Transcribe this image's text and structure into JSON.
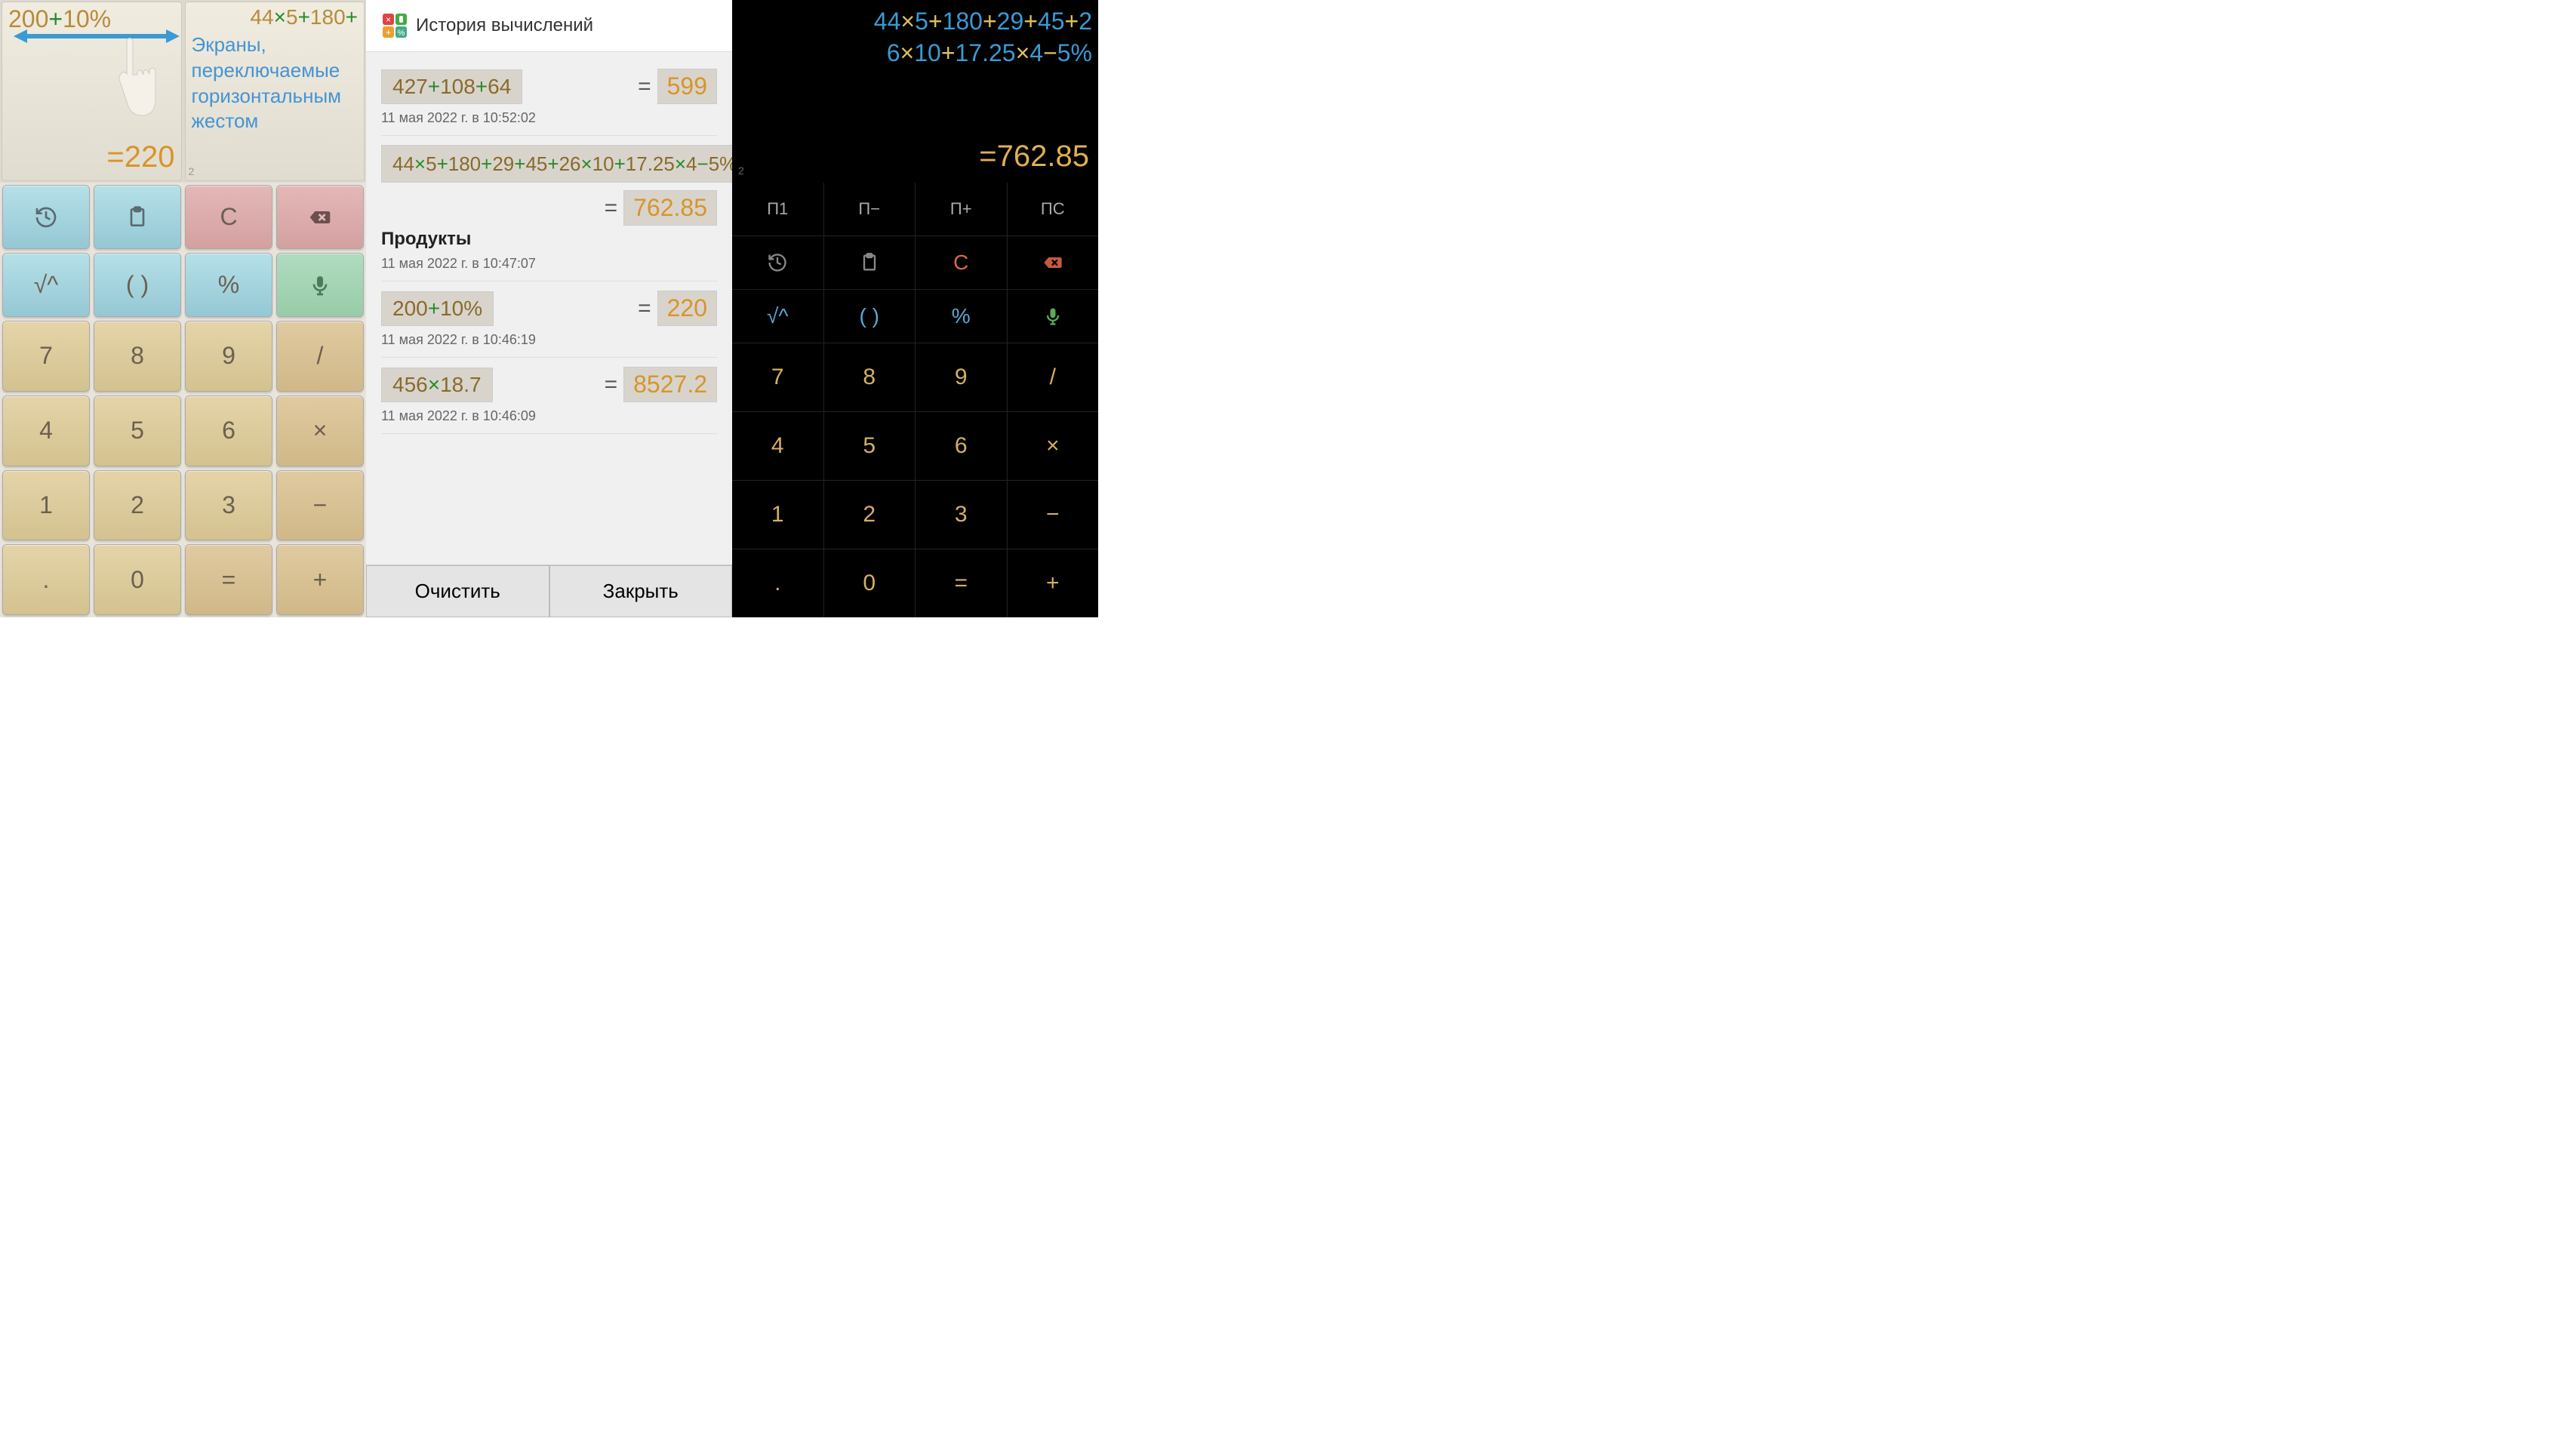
{
  "panel1": {
    "tab1": {
      "expr_parts": [
        "200",
        "+",
        "10%"
      ],
      "result": "=220"
    },
    "tab2": {
      "expr_parts": [
        "44",
        "×",
        "5",
        "+",
        "180",
        "+"
      ],
      "hint": "Экраны, переключаемые горизонтальным жестом",
      "page": "2"
    },
    "keys": {
      "c": "C",
      "root": "√^",
      "paren": "( )",
      "pct": "%",
      "n7": "7",
      "n8": "8",
      "n9": "9",
      "div": "/",
      "n4": "4",
      "n5": "5",
      "n6": "6",
      "mul": "×",
      "n1": "1",
      "n2": "2",
      "n3": "3",
      "sub": "−",
      "dot": ".",
      "n0": "0",
      "eq": "=",
      "add": "+"
    }
  },
  "panel2": {
    "title": "История вычислений",
    "entries": [
      {
        "expr_parts": [
          "427",
          "+",
          "108",
          "+",
          "64"
        ],
        "result": "599",
        "time": "11 мая 2022 г. в 10:52:02"
      },
      {
        "big": true,
        "expr_parts": [
          "44",
          "×",
          "5",
          "+",
          "180",
          "+",
          "29",
          "+",
          "45",
          "+",
          "26",
          "×",
          "10",
          "+",
          "17.25",
          "×",
          "4",
          "−",
          "5%"
        ],
        "result": "762.85",
        "label": "Продукты",
        "time": "11 мая 2022 г. в 10:47:07"
      },
      {
        "expr_parts": [
          "200",
          "+",
          "10%"
        ],
        "result": "220",
        "time": "11 мая 2022 г. в 10:46:19"
      },
      {
        "expr_parts": [
          "456",
          "×",
          "18.7"
        ],
        "result": "8527.2",
        "time": "11 мая 2022 г. в 10:46:09"
      }
    ],
    "eq": "=",
    "clear": "Очистить",
    "close": "Закрыть"
  },
  "panel3": {
    "expr_line1_parts": [
      "44",
      "×",
      "5",
      "+",
      "180",
      "+",
      "29",
      "+",
      "45",
      "+",
      "2"
    ],
    "expr_line2_parts": [
      "6",
      "×",
      "10",
      "+",
      "17.25",
      "×",
      "4",
      "−",
      "5%"
    ],
    "result": "=762.85",
    "page": "2",
    "keys": {
      "m1": "П1",
      "mminus": "П−",
      "mplus": "П+",
      "mc": "ПС",
      "c": "C",
      "root": "√^",
      "paren": "( )",
      "pct": "%",
      "n7": "7",
      "n8": "8",
      "n9": "9",
      "div": "/",
      "n4": "4",
      "n5": "5",
      "n6": "6",
      "mul": "×",
      "n1": "1",
      "n2": "2",
      "n3": "3",
      "sub": "−",
      "dot": ".",
      "n0": "0",
      "eq": "=",
      "add": "+"
    }
  }
}
